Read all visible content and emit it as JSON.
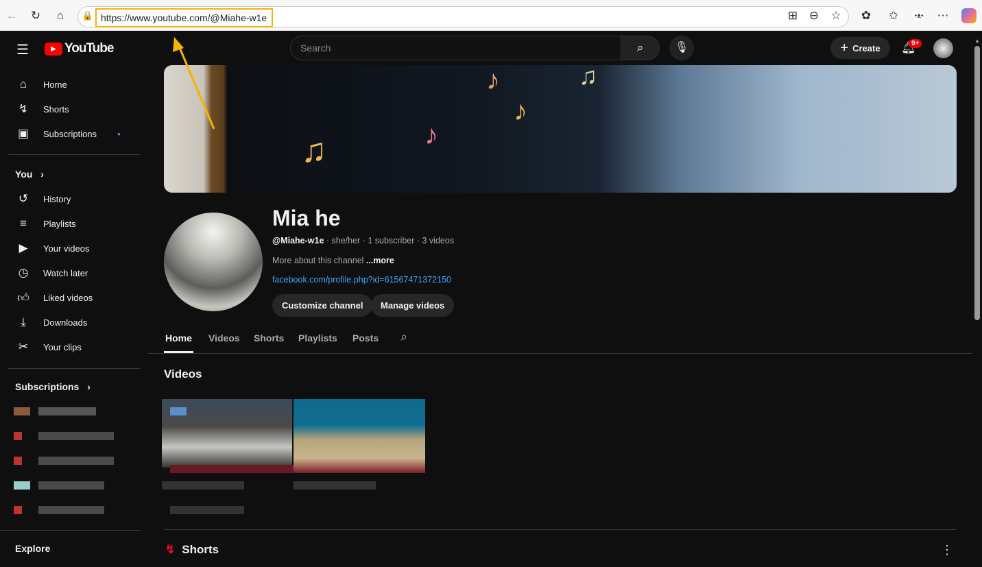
{
  "browser": {
    "url": "https://www.youtube.com/@Miahe-w1e"
  },
  "header": {
    "logo": "YouTube",
    "search_placeholder": "Search",
    "create_label": "Create",
    "notification_badge": "9+"
  },
  "sidebar": {
    "main": [
      {
        "label": "Home",
        "icon": "home-icon"
      },
      {
        "label": "Shorts",
        "icon": "shorts-icon"
      },
      {
        "label": "Subscriptions",
        "icon": "subscriptions-icon"
      }
    ],
    "you_label": "You",
    "you": [
      {
        "label": "History"
      },
      {
        "label": "Playlists"
      },
      {
        "label": "Your videos"
      },
      {
        "label": "Watch later"
      },
      {
        "label": "Liked videos"
      },
      {
        "label": "Downloads"
      },
      {
        "label": "Your clips"
      }
    ],
    "subscriptions_label": "Subscriptions",
    "explore_label": "Explore"
  },
  "channel": {
    "name": "Mia he",
    "handle": "@Miahe-w1e",
    "meta": " · she/her · 1 subscriber · 3 videos",
    "about": "More about this channel ",
    "more": "...more",
    "link": "facebook.com/profile.php?id=61567471372150",
    "customize": "Customize channel",
    "manage": "Manage videos"
  },
  "tabs": [
    "Home",
    "Videos",
    "Shorts",
    "Playlists",
    "Posts"
  ],
  "sections": {
    "videos": "Videos",
    "shorts": "Shorts"
  }
}
